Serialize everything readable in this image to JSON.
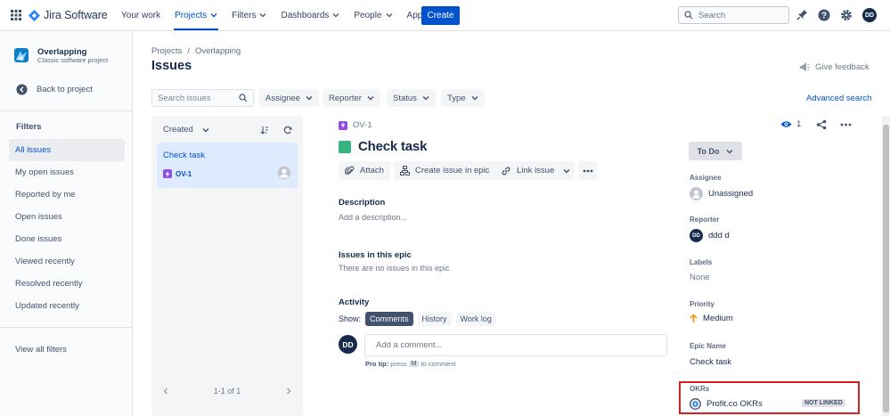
{
  "topbar": {
    "product": "Jira Software",
    "nav": [
      {
        "label": "Your work",
        "dropdown": false
      },
      {
        "label": "Projects",
        "dropdown": true,
        "active": true
      },
      {
        "label": "Filters",
        "dropdown": true
      },
      {
        "label": "Dashboards",
        "dropdown": true
      },
      {
        "label": "People",
        "dropdown": true
      },
      {
        "label": "Apps",
        "dropdown": true
      }
    ],
    "create_label": "Create",
    "search_placeholder": "Search",
    "user_initials": "DD"
  },
  "sidebar": {
    "project_name": "Overlapping",
    "project_type": "Classic software project",
    "back_label": "Back to project",
    "filters_heading": "Filters",
    "filters": [
      "All issues",
      "My open issues",
      "Reported by me",
      "Open issues",
      "Done issues",
      "Viewed recently",
      "Resolved recently",
      "Updated recently"
    ],
    "active_filter": 0,
    "view_all": "View all filters"
  },
  "header": {
    "breadcrumb": [
      "Projects",
      "Overlapping"
    ],
    "title": "Issues",
    "feedback": "Give feedback"
  },
  "filterbar": {
    "search_placeholder": "Search issues",
    "dropdowns": [
      "Assignee",
      "Reporter",
      "Status",
      "Type"
    ],
    "advanced": "Advanced search"
  },
  "list": {
    "sort_label": "Created",
    "items": [
      {
        "summary": "Check task",
        "key": "OV-1"
      }
    ],
    "pagination": "1-1 of 1"
  },
  "detail": {
    "key": "OV-1",
    "title": "Check task",
    "actions": {
      "attach": "Attach",
      "create_in_epic": "Create issue in epic",
      "link_issue": "Link issue"
    },
    "description_h": "Description",
    "description_ph": "Add a description...",
    "epic_h": "Issues in this epic",
    "epic_empty": "There are no issues in this epic",
    "activity_h": "Activity",
    "show_label": "Show:",
    "activity_tabs": [
      "Comments",
      "History",
      "Work log"
    ],
    "comment_avatar": "DD",
    "comment_ph": "Add a comment...",
    "protip_bold": "Pro tip:",
    "protip_press": "press",
    "protip_key": "M",
    "protip_rest": "to comment",
    "watch_count": "1"
  },
  "fields": {
    "status": "To Do",
    "assignee_l": "Assignee",
    "assignee_v": "Unassigned",
    "reporter_l": "Reporter",
    "reporter_v": "ddd d",
    "reporter_initials": "DD",
    "labels_l": "Labels",
    "labels_v": "None",
    "priority_l": "Priority",
    "priority_v": "Medium",
    "epic_l": "Epic Name",
    "epic_v": "Check task",
    "okr_l": "OKRs",
    "okr_v": "Profit.co OKRs",
    "okr_badge": "NOT LINKED"
  },
  "colors": {
    "primary": "#0052cc",
    "task": "#36b37e",
    "epic": "#904ee2",
    "highlight": "#d31f26",
    "priority_medium": "#ff8b00"
  }
}
